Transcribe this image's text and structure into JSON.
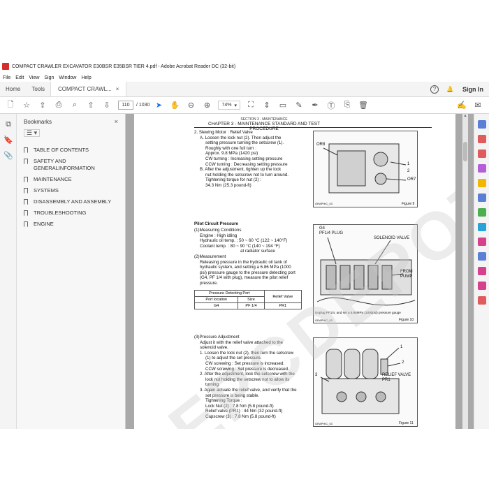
{
  "window": {
    "title": "COMPACT CRAWLER EXCAVATOR E30BSR E35BSR TIER 4.pdf - Adobe Acrobat Reader DC (32-bit)"
  },
  "menu": [
    "File",
    "Edit",
    "View",
    "Sign",
    "Window",
    "Help"
  ],
  "tabs": {
    "home": "Home",
    "tools": "Tools",
    "document": "COMPACT CRAWL...",
    "close": "×"
  },
  "header_right": {
    "help": "?",
    "bell": "🔔",
    "signin": "Sign In"
  },
  "toolbar": {
    "page_current": "110",
    "page_total": "/ 1030",
    "zoom": "74%"
  },
  "bookmarks": {
    "title": "Bookmarks",
    "close": "×",
    "tool": "☰ ▾",
    "items": [
      "TABLE OF CONTENTS",
      "SAFETY AND GENERALINFORMATION",
      "MAINTENANCE",
      "SYSTEMS",
      "DISASSEMBLY AND ASSEMBLY",
      "TROUBLESHOOTING",
      "ENGINE"
    ]
  },
  "document": {
    "section": "SECTION 3 - MAINTENANCE",
    "chapter": "CHAPTER 3 - MAINTENANCE STANDARD AND TEST PROCEDURE",
    "slewing": [
      "2. Slewing Motor : Relief Valve",
      "A. Loosen the lock nut (2). Then adjust the",
      "setting pressure turning the setscrew (1).",
      "Roughly with one full turn :",
      "Approx. 9.8 MPa (1420 psi)",
      "CW turning : Increasing setting pressure",
      "CCW turning : Decreasing setting pressure",
      "B. After the adjustment, tighten up the lock",
      "nut holding the setscrew not to turn around.",
      "Tightening torque for nut (2) :",
      "34.3 Nm (25.3 pound-ft)"
    ],
    "pilot_title": "Pilot Circuit Pressure",
    "pilot": [
      "(1)Measuring Conditions",
      "Engine : High idling",
      "Hydraulic oil temp. : 50 ~ 60 °C (122 ~ 140°F)",
      "Coolant temp. : 80 ~ 90 °C (140 ~ 194 °F)",
      "at radiator surface",
      "(2)Measurement",
      "Releasing pressure in the hydraulic oil tank of",
      "hydraulic system, and setting a 6.86 MPa (1000",
      "psi) pressure gauge to the pressure detecting port",
      "(G4, PF 1/4 with plug), measure the pilot relief",
      "pressure."
    ],
    "table": {
      "h1": "Pressure Detecting Port",
      "h2": "Relief Valve",
      "c1": "Port location",
      "c2": "Size",
      "r1": "G4",
      "r2": "PF 1/4",
      "r3": "PR1"
    },
    "adjust": [
      "(3)Pressure Adjustment",
      "Adjust it with the relief valve attached to the",
      "solenoid valve.",
      "1. Loosen the lock nut (2), then turn the setscrew",
      "(1) to adjust the set pressure.",
      "CW screwing : Set pressure is increased.",
      "CCW screwing : Set pressure is decreased.",
      "2. After the adjustment, lock the setscrew with the",
      "lock nut holding the setscrew not to allow its",
      "turning.",
      "3. Again actuate the relief valve, and verify that the",
      "set pressure is being stable.",
      "Tightening Torque :",
      "Lock Nut (2) : 7.8 Nm (5.8 pound-ft)",
      "Relief valve (PR1) : 44 Nm (32 pound-ft)",
      "Capscrew (3) : 7.8 Nm (5.8 pound-ft)"
    ],
    "fig9": {
      "caption": "Figure 9",
      "code": "GRAPHIC_03",
      "l1": "OR8",
      "l2": "OR7",
      "l3": "1",
      "l4": "2"
    },
    "fig10": {
      "caption": "Figure 10",
      "code": "GRAPHIC_03",
      "l1": "G4",
      "l2": "PF1/4 PLUG",
      "l3": "SOLENOID VALVE",
      "l4": "FROM",
      "l5": "PUMP",
      "note": "Unplug PF1/4, and set a 6.86MPa (1000psi) pressure gauge"
    },
    "fig11": {
      "caption": "Figure 11",
      "code": "GRAPHIC_03",
      "l1": "1",
      "l2": "2",
      "l3": "3",
      "l4": "RELIEF VALVE",
      "l5": "PR1"
    },
    "watermark": "EPCDEPOT.COM"
  }
}
